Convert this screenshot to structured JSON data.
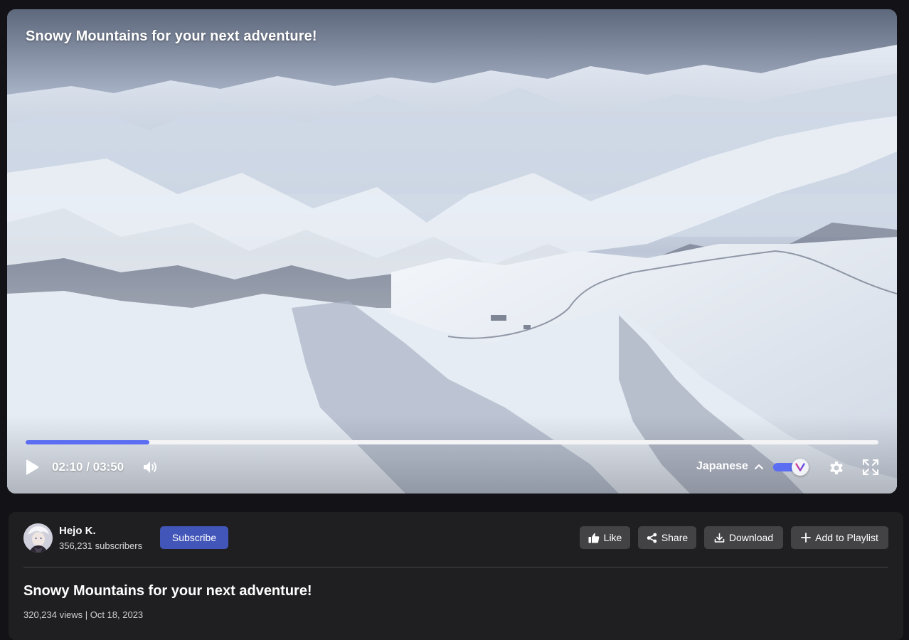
{
  "video": {
    "title": "Snowy Mountains for your next adventure!",
    "current_time": "02:10",
    "duration": "03:50",
    "time_display": "02:10 / 03:50",
    "progress": 0.145,
    "language": "Japanese",
    "toggle_on": true,
    "toggle_knob_label": "V",
    "icons": {
      "play": "play-icon",
      "volume": "volume-icon",
      "language": "chevron-up-icon",
      "settings": "gear-icon",
      "fullscreen": "fullscreen-icon"
    }
  },
  "channel": {
    "name": "Hejo K.",
    "subscribers": "356,231 subscribers",
    "subscribe_label": "Subscribe"
  },
  "actions": {
    "like_label": "Like",
    "share_label": "Share",
    "download_label": "Download",
    "playlist_label": "Add to Playlist"
  },
  "details": {
    "title": "Snowy Mountains for your next adventure!",
    "meta": "320,234 views | Oct 18, 2023"
  },
  "colors": {
    "accent": "#5b6ef2",
    "subscribe": "#4255b8",
    "card": "#1f1f21",
    "page_bg": "#131217"
  }
}
